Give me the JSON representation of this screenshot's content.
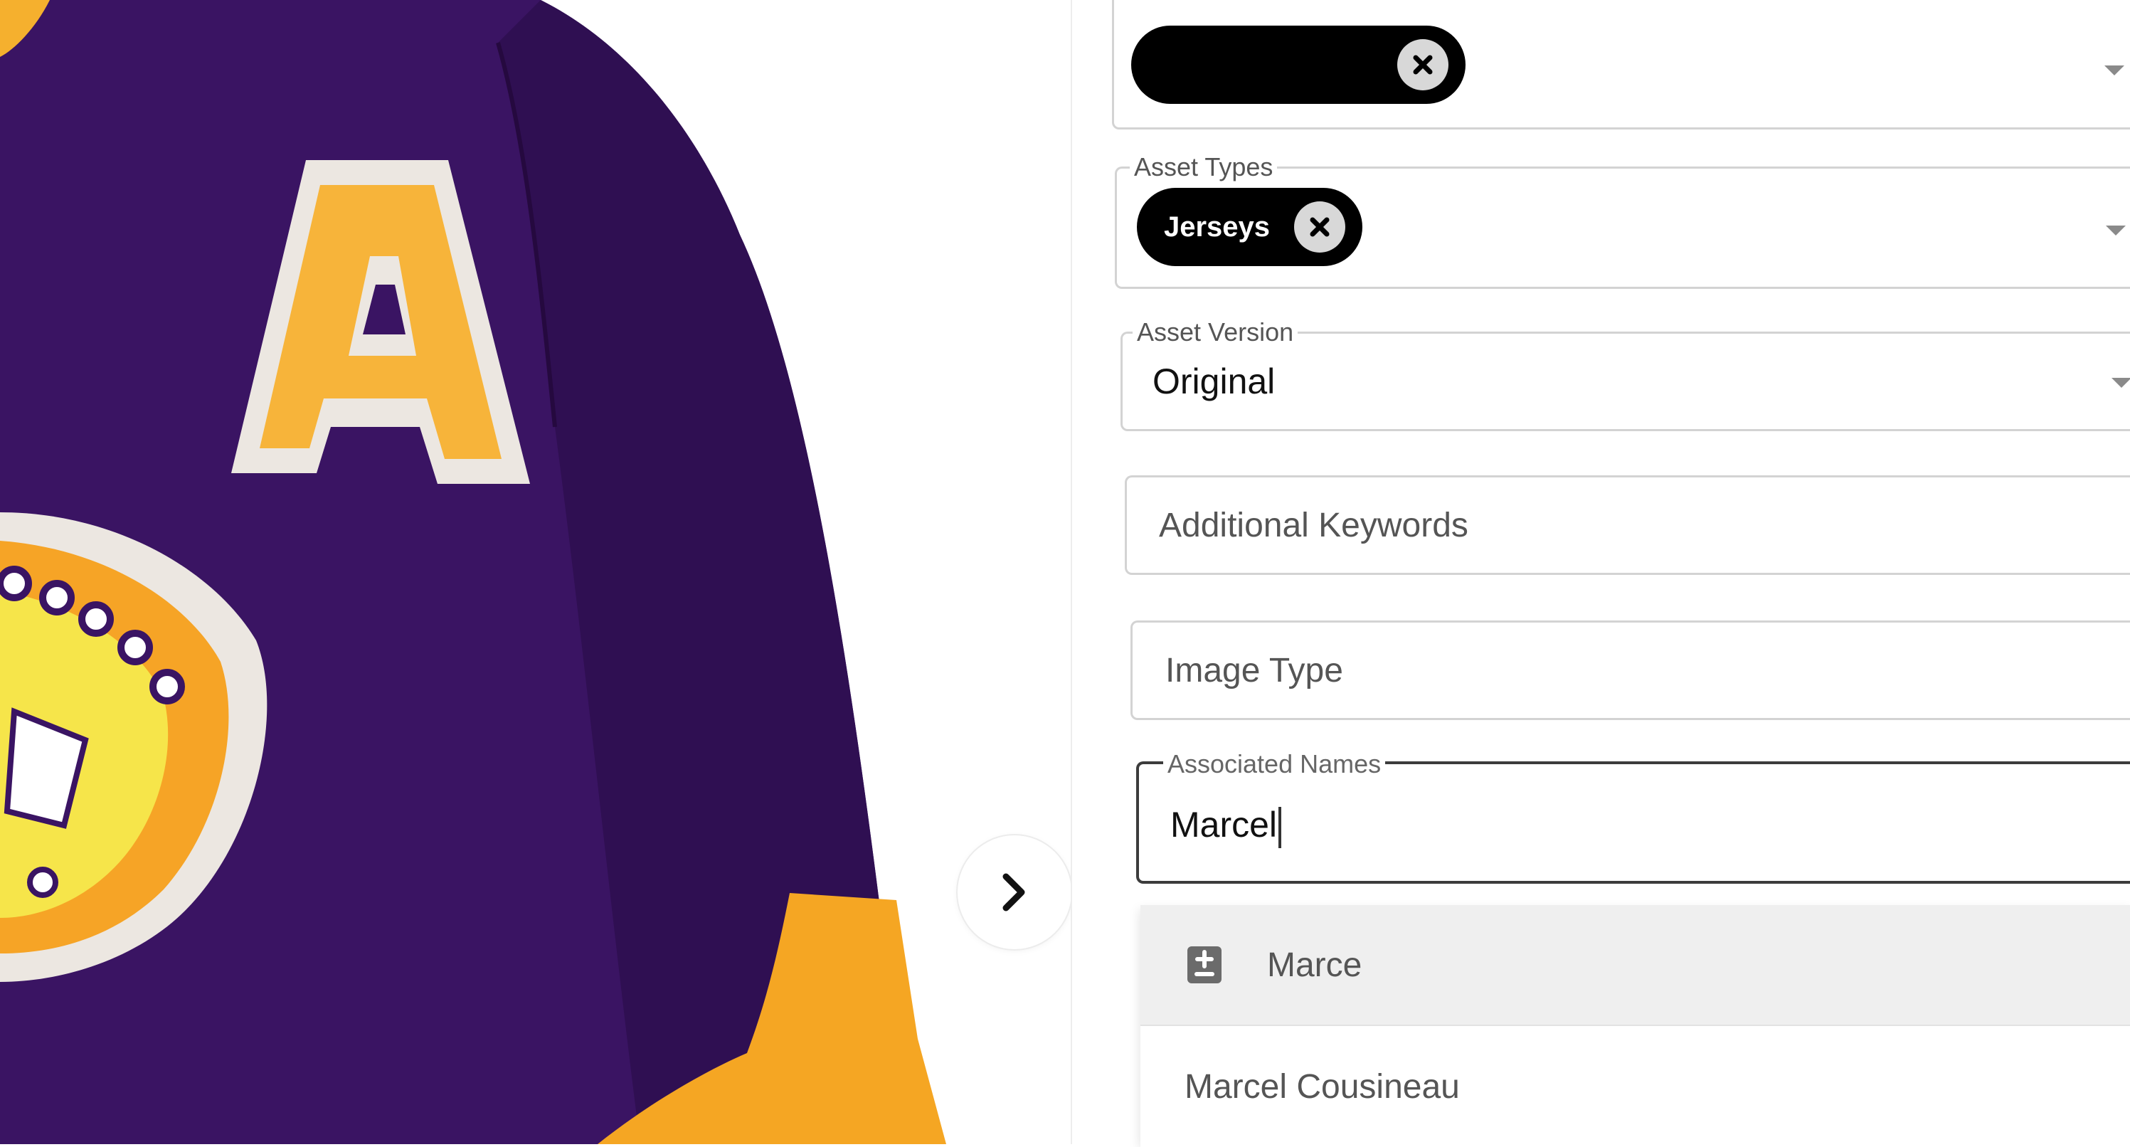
{
  "form": {
    "top_field": {
      "chip_label": "",
      "icons": {
        "chip_close": "close-circle-icon",
        "dropdown": "chevron-down-icon"
      }
    },
    "asset_types": {
      "label": "Asset Types",
      "chip_label": "Jerseys"
    },
    "asset_version": {
      "label": "Asset Version",
      "value": "Original"
    },
    "additional_keywords": {
      "placeholder": "Additional Keywords"
    },
    "image_type": {
      "placeholder": "Image Type"
    },
    "associated_names": {
      "label": "Associated Names",
      "value": "Marcel"
    }
  },
  "suggestions": [
    {
      "label": "Marce",
      "icon": "add-contact-icon"
    },
    {
      "label": "Marcel Cousineau"
    }
  ],
  "nav": {
    "next_icon": "chevron-right-icon"
  },
  "colors": {
    "jersey_purple": "#3a1463",
    "jersey_gold": "#f5b02e",
    "chip_black": "#000000"
  }
}
